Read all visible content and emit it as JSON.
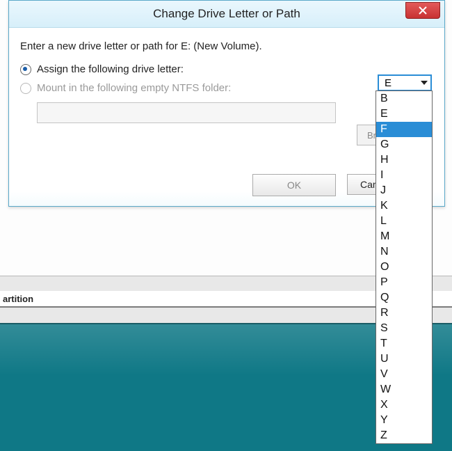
{
  "dialog": {
    "title": "Change Drive Letter or Path",
    "instruction": "Enter a new drive letter or path for E: (New Volume).",
    "assign_option": {
      "label": "Assign the following drive letter:",
      "selected": true
    },
    "mount_option": {
      "label": "Mount in the following empty NTFS folder:",
      "selected": false,
      "enabled": false
    },
    "browse_button": "Browse...",
    "ok_button": "OK",
    "cancel_button": "Cancel"
  },
  "drive_letter_combo": {
    "value": "E",
    "highlighted": "F",
    "options": [
      "B",
      "E",
      "F",
      "G",
      "H",
      "I",
      "J",
      "K",
      "L",
      "M",
      "N",
      "O",
      "P",
      "Q",
      "R",
      "S",
      "T",
      "U",
      "V",
      "W",
      "X",
      "Y",
      "Z"
    ]
  },
  "background": {
    "section_label": "artition"
  }
}
